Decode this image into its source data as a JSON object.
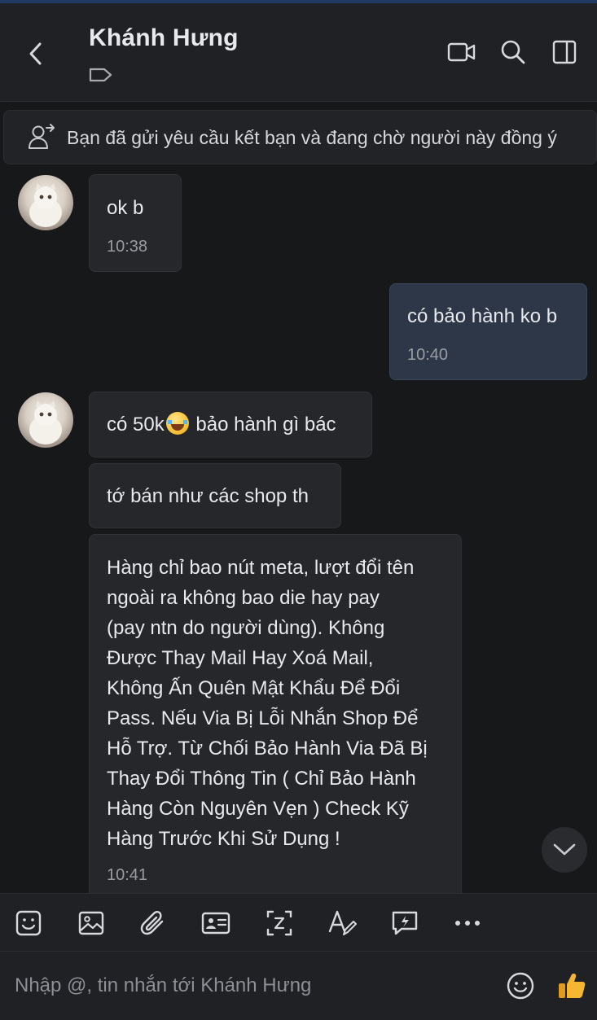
{
  "header": {
    "contact_name": "Khánh Hưng",
    "icons": [
      "back-icon",
      "tag-icon",
      "video-call-icon",
      "search-icon",
      "sidebar-toggle-icon"
    ]
  },
  "banner": {
    "text": "Bạn đã gửi yêu cầu kết bạn và đang chờ người này đồng ý",
    "icon": "user-request-icon"
  },
  "messages": [
    {
      "direction": "in",
      "lines": [
        "ok b"
      ],
      "time": "10:38"
    },
    {
      "direction": "out",
      "lines": [
        "có bảo hành ko b"
      ],
      "time": "10:40"
    },
    {
      "direction": "in",
      "text_before_emoji": "có 50k",
      "emoji": "laughing-tears-emoji",
      "text_after_emoji": " bảo hành gì bác"
    },
    {
      "direction": "in",
      "lines": [
        "tớ bán như các shop th"
      ]
    },
    {
      "direction": "in",
      "lines": [
        "Hàng chỉ bao nút meta, lượt đổi tên",
        "ngoài ra không bao die hay pay",
        "(pay ntn do người dùng). Không",
        "Được Thay Mail Hay Xoá Mail,",
        "Không Ấn Quên Mật Khẩu Để Đổi",
        "Pass. Nếu Via Bị Lỗi Nhắn Shop Để",
        "Hỗ Trợ. Từ Chối Bảo Hành Via Đã Bị",
        "Thay Đổi Thông Tin ( Chỉ Bảo Hành",
        "Hàng Còn Nguyên Vẹn ) Check Kỹ",
        "Hàng Trước Khi Sử Dụng !"
      ],
      "time": "10:41"
    }
  ],
  "toolbar": {
    "icons": [
      "sticker-icon",
      "image-icon",
      "attachment-icon",
      "contact-card-icon",
      "screenshot-icon",
      "text-format-icon",
      "quick-message-icon",
      "more-icon"
    ]
  },
  "composer": {
    "placeholder": "Nhập @, tin nhắn tới Khánh Hưng",
    "value": ""
  },
  "colors": {
    "background": "#171819",
    "header_bg": "#202124",
    "incoming_bubble": "#26272a",
    "outgoing_bubble": "#2d3748",
    "time_text": "#9a9ca3",
    "like_icon": "#f5b731"
  }
}
